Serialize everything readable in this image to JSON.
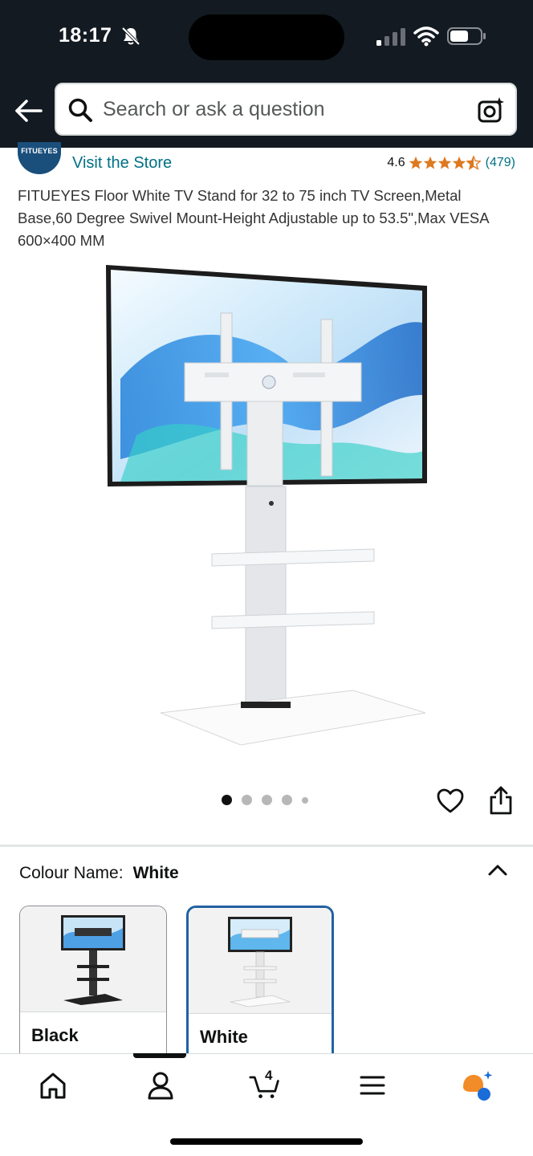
{
  "status_bar": {
    "time": "18:17"
  },
  "header": {
    "search_placeholder": "Search or ask a question"
  },
  "store": {
    "logo_text": "FITUEYES",
    "visit_label": "Visit the Store",
    "rating_value": "4.6",
    "rating_stars": 4.6,
    "rating_count": "(479)"
  },
  "product": {
    "title": "FITUEYES Floor White TV Stand for 32 to 75 inch TV Screen,Metal Base,60 Degree Swivel Mount-Height Adjustable up to 53.5\",Max VESA 600×400 MM"
  },
  "carousel": {
    "total_dots": 5,
    "active_index": 0
  },
  "colour": {
    "label": "Colour Name:",
    "selected": "White",
    "options": [
      {
        "name": "Black",
        "selected": false
      },
      {
        "name": "White",
        "selected": true
      }
    ]
  },
  "bottom_nav": {
    "items": [
      "home-icon",
      "account-icon",
      "cart-icon",
      "menu-icon",
      "rufus-icon"
    ],
    "cart_count": "4",
    "active_item": "account-icon"
  },
  "colors": {
    "header_bg": "#131a22",
    "link": "#007185",
    "star": "#de7921",
    "selected_border": "#2162a1"
  }
}
